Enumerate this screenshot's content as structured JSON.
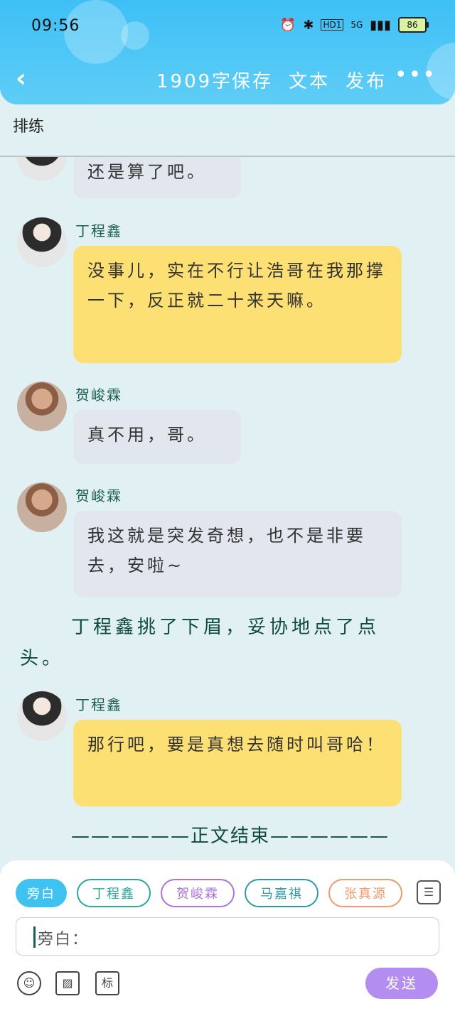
{
  "status": {
    "time": "09:56",
    "hd": "HD1",
    "net": "5G",
    "battery": "86"
  },
  "nav": {
    "back": "‹",
    "title": "1909字",
    "save": "保存",
    "text": "文本",
    "publish": "发布",
    "more": "•••"
  },
  "section": "排练",
  "messages": [
    {
      "speaker": "",
      "text": "还是算了吧。"
    },
    {
      "speaker": "丁程鑫",
      "text": "没事儿，实在不行让浩哥在我那撑一下，反正就二十来天嘛。"
    },
    {
      "speaker": "贺峻霖",
      "text": "真不用，哥。"
    },
    {
      "speaker": "贺峻霖",
      "text": "我这就是突发奇想，也不是非要去，安啦~"
    },
    {
      "speaker": "丁程鑫",
      "text": "那行吧，要是真想去随时叫哥哈！"
    }
  ],
  "narration": "丁程鑫挑了下眉，妥协地点了点头。",
  "end_text": "——————正文结束——————",
  "chips": [
    "旁白",
    "丁程鑫",
    "贺峻霖",
    "马嘉祺",
    "张真源"
  ],
  "chip_colors": [
    "#3fc2ef",
    "#2aa79a",
    "#a975d9",
    "#2f9aa7",
    "#ef9a6a"
  ],
  "input": {
    "label": "旁白："
  },
  "tools": {
    "emoji": "☺",
    "image": "▨",
    "mark": "标"
  },
  "send": "发送",
  "colors": {
    "header": "#3ec0f5",
    "bg": "#e1f1f3",
    "yellow": "#fde074",
    "gray": "#e2e6ee"
  }
}
